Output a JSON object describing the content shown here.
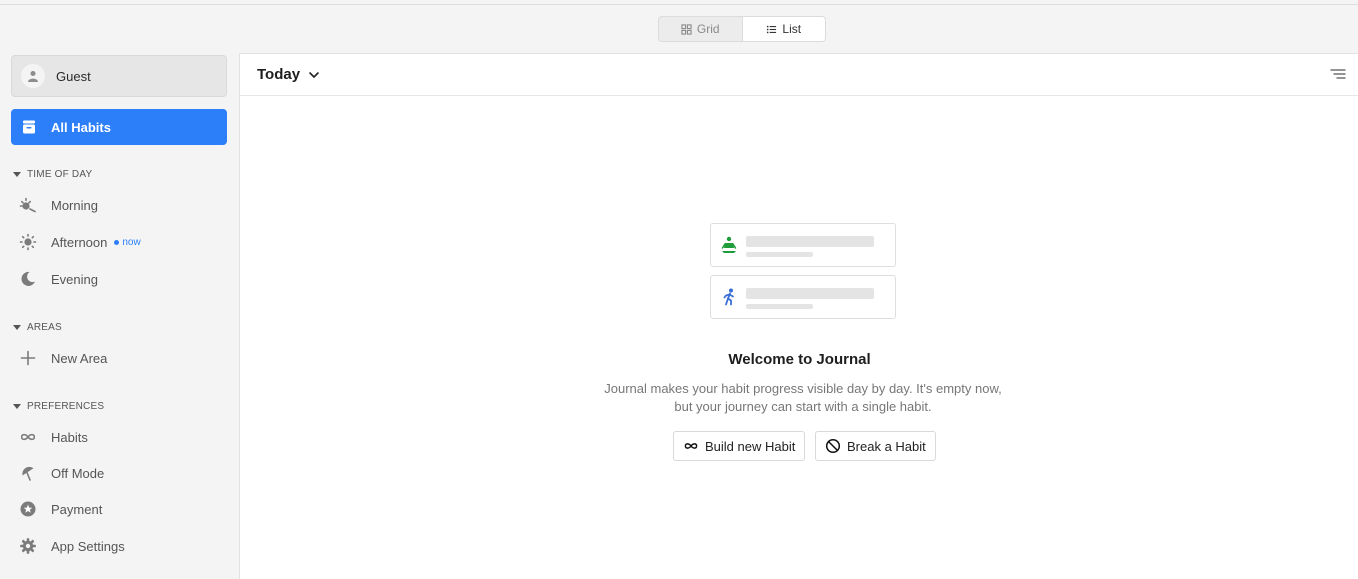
{
  "view_toggle": {
    "grid_label": "Grid",
    "list_label": "List",
    "active": "list"
  },
  "sidebar": {
    "guest_label": "Guest",
    "all_habits_label": "All Habits",
    "time_of_day": {
      "header": "TIME OF DAY",
      "morning": "Morning",
      "afternoon": "Afternoon",
      "afternoon_badge": "now",
      "evening": "Evening"
    },
    "areas": {
      "header": "AREAS",
      "new_area": "New Area"
    },
    "preferences": {
      "header": "PREFERENCES",
      "habits": "Habits",
      "off_mode": "Off Mode",
      "payment": "Payment",
      "app_settings": "App Settings"
    }
  },
  "main": {
    "period_label": "Today",
    "empty_state": {
      "title": "Welcome to Journal",
      "description": "Journal makes your habit progress visible day by day. It's empty now, but your journey can start with a single habit.",
      "build_button": "Build new Habit",
      "break_button": "Break a Habit"
    }
  },
  "colors": {
    "accent": "#2d7ff9",
    "green_icon": "#1f9d3a",
    "blue_icon": "#3a6fd8"
  }
}
